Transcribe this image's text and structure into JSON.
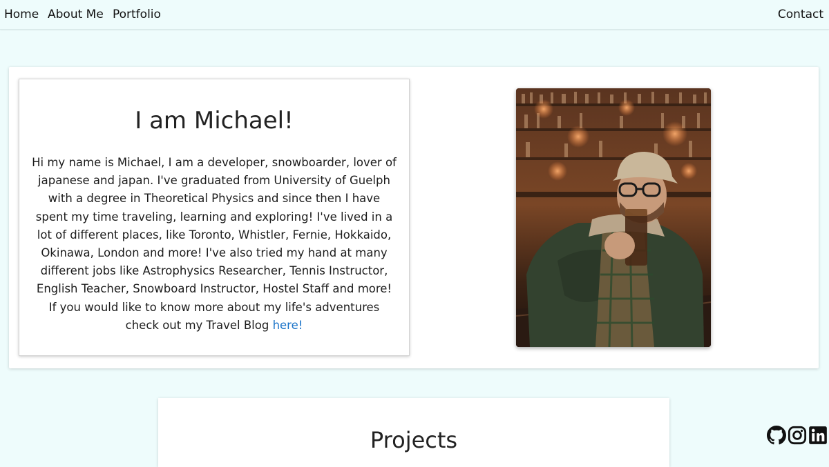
{
  "nav": {
    "home": "Home",
    "about": "About Me",
    "portfolio": "Portfolio",
    "contact": "Contact"
  },
  "about": {
    "title": "I am Michael!",
    "body": "Hi my name is Michael, I am a developer, snowboarder, lover of japanese and japan. I've graduated from University of Guelph with a degree in Theoretical Physics and since then I have spent my time traveling, learning and exploring! I've lived in a lot of different places, like Toronto, Whistler, Fernie, Hokkaido, Okinawa, London and more! I've also tried my hand at many different jobs like Astrophysics Researcher, Tennis Instructor, English Teacher, Snowboard Instructor, Hostel Staff and more! If you would like to know more about my life's adventures check out my Travel Blog",
    "link_label": "here!"
  },
  "projects": {
    "title": "Projects"
  },
  "social": {
    "icons": [
      "github-icon",
      "instagram-icon",
      "linkedin-icon"
    ]
  },
  "colors": {
    "page_background": "#eefcfc",
    "link": "#1a73c8"
  }
}
